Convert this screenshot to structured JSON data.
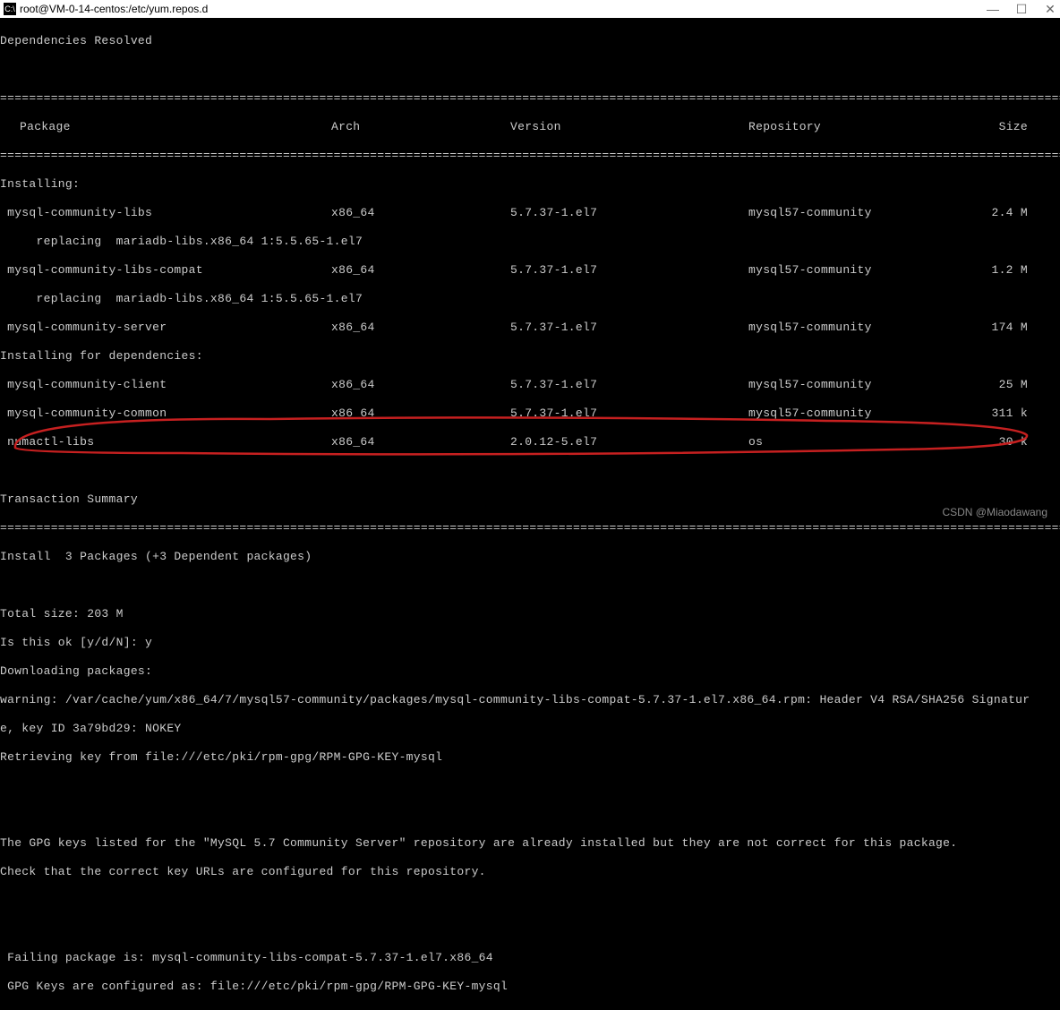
{
  "window": {
    "icon_text": "C:\\",
    "title": "root@VM-0-14-centos:/etc/yum.repos.d"
  },
  "terminal": {
    "deps_resolved": "Dependencies Resolved",
    "headers": {
      "package": "Package",
      "arch": "Arch",
      "version": "Version",
      "repository": "Repository",
      "size": "Size"
    },
    "section_installing": "Installing:",
    "section_deps": "Installing for dependencies:",
    "packages": [
      {
        "name": " mysql-community-libs",
        "arch": "x86_64",
        "version": "5.7.37-1.el7",
        "repo": "mysql57-community",
        "size": "2.4 M"
      },
      {
        "name": " mysql-community-libs-compat",
        "arch": "x86_64",
        "version": "5.7.37-1.el7",
        "repo": "mysql57-community",
        "size": "1.2 M"
      },
      {
        "name": " mysql-community-server",
        "arch": "x86_64",
        "version": "5.7.37-1.el7",
        "repo": "mysql57-community",
        "size": "174 M"
      }
    ],
    "replacing": "     replacing  mariadb-libs.x86_64 1:5.5.65-1.el7",
    "dep_packages": [
      {
        "name": " mysql-community-client",
        "arch": "x86_64",
        "version": "5.7.37-1.el7",
        "repo": "mysql57-community",
        "size": "25 M"
      },
      {
        "name": " mysql-community-common",
        "arch": "x86_64",
        "version": "5.7.37-1.el7",
        "repo": "mysql57-community",
        "size": "311 k"
      },
      {
        "name": " numactl-libs",
        "arch": "x86_64",
        "version": "2.0.12-5.el7",
        "repo": "os",
        "size": "30 k"
      }
    ],
    "tx_summary": "Transaction Summary",
    "install_line": "Install  3 Packages (+3 Dependent packages)",
    "total_size": "Total size: 203 M",
    "is_ok": "Is this ok [y/d/N]: y",
    "downloading": "Downloading packages:",
    "warning1": "warning: /var/cache/yum/x86_64/7/mysql57-community/packages/mysql-community-libs-compat-5.7.37-1.el7.x86_64.rpm: Header V4 RSA/SHA256 Signatur",
    "warning2": "e, key ID 3a79bd29: NOKEY",
    "retrieving": "Retrieving key from file:///etc/pki/rpm-gpg/RPM-GPG-KEY-mysql",
    "gpg_line1": "The GPG keys listed for the \"MySQL 5.7 Community Server\" repository are already installed but they are not correct for this package.",
    "gpg_line2": "Check that the correct key URLs are configured for this repository.",
    "failing": " Failing package is: mysql-community-libs-compat-5.7.37-1.el7.x86_64",
    "gpg_keys": " GPG Keys are configured as: file:///etc/pki/rpm-gpg/RPM-GPG-KEY-mysql"
  },
  "watermark": "CSDN @Miaodawang",
  "divider_char": "="
}
